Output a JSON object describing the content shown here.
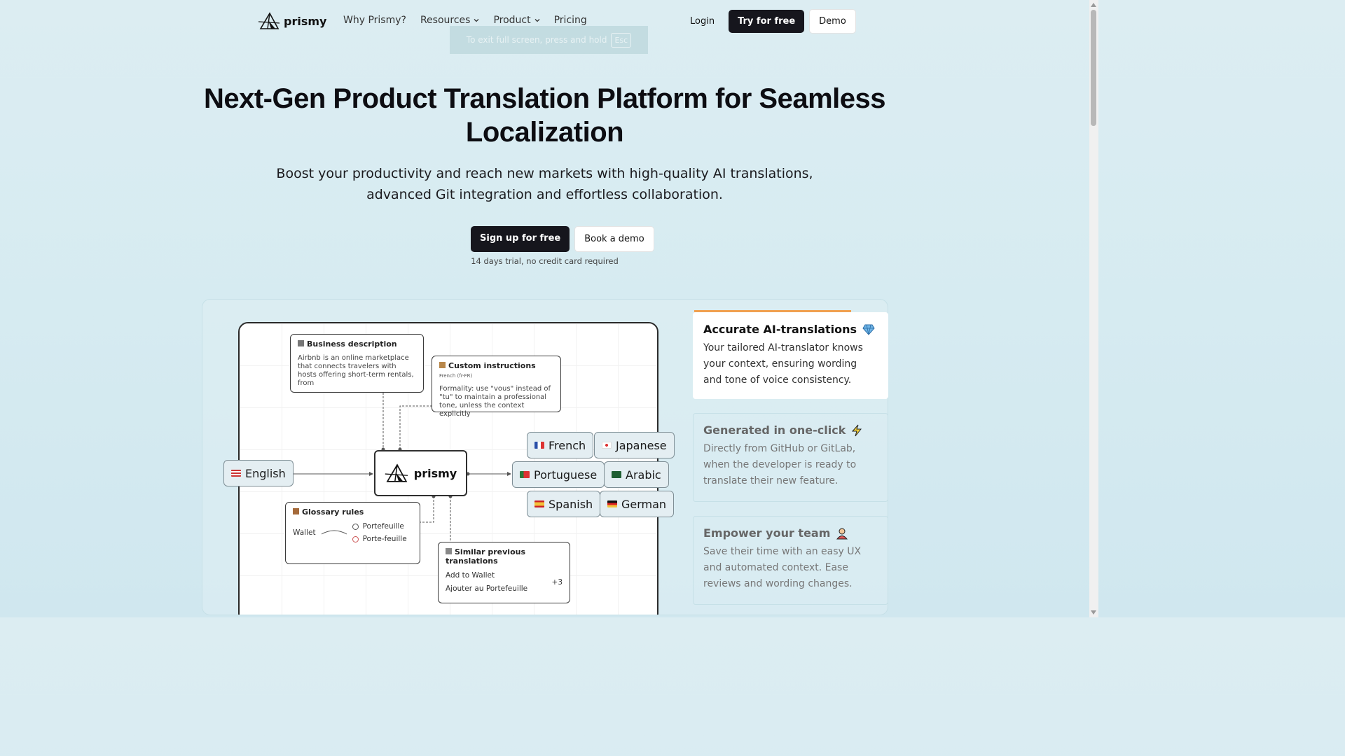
{
  "nav": {
    "brand": "prismy",
    "links": [
      {
        "label": "Why Prismy?",
        "has_dropdown": false
      },
      {
        "label": "Resources",
        "has_dropdown": true
      },
      {
        "label": "Product",
        "has_dropdown": true
      },
      {
        "label": "Pricing",
        "has_dropdown": false
      }
    ],
    "login": "Login",
    "try_free": "Try for free",
    "demo": "Demo"
  },
  "toast": {
    "text": "To exit full screen, press and hold",
    "key": "Esc"
  },
  "hero": {
    "title_line1": "Next-Gen Product Translation Platform for Seamless",
    "title_line2": "Localization",
    "subtitle_line1": "Boost your productivity and reach new markets with high-quality AI translations,",
    "subtitle_line2": "advanced Git integration and effortless collaboration.",
    "cta_primary": "Sign up for free",
    "cta_secondary": "Book a demo",
    "trial_note": "14 days trial, no credit card required"
  },
  "diagram": {
    "business": {
      "title": "Business description",
      "body": "Airbnb is an online marketplace that connects travelers with hosts offering short-term rentals, from"
    },
    "custom": {
      "title": "Custom instructions",
      "tag": "French (fr-FR)",
      "body": "Formality: use \"vous\" instead of \"tu\" to maintain a professional tone, unless the context explicitly"
    },
    "source_lang": "English",
    "center_brand": "prismy",
    "targets": [
      "French",
      "Japanese",
      "Portuguese",
      "Arabic",
      "Spanish",
      "German"
    ],
    "glossary": {
      "title": "Glossary rules",
      "source": "Wallet",
      "ok": "Portefeuille",
      "bad": "Porte-feuille"
    },
    "similar": {
      "title": "Similar previous translations",
      "en": "Add to Wallet",
      "fr": "Ajouter au Portefeuille",
      "more": "+3"
    }
  },
  "features": [
    {
      "title": "Accurate AI-translations",
      "icon": "gem-icon",
      "desc": "Your tailored AI-translator knows your context, ensuring wording and tone of voice consistency."
    },
    {
      "title": "Generated in one-click",
      "icon": "lightning-icon",
      "desc": "Directly from GitHub or GitLab, when the developer is ready to translate their new feature."
    },
    {
      "title": "Empower your team",
      "icon": "person-icon",
      "desc": "Save their time with an easy UX and automated context. Ease reviews and wording changes."
    }
  ],
  "colors": {
    "dark_button": "#16161d",
    "progress": "#f0a050"
  }
}
